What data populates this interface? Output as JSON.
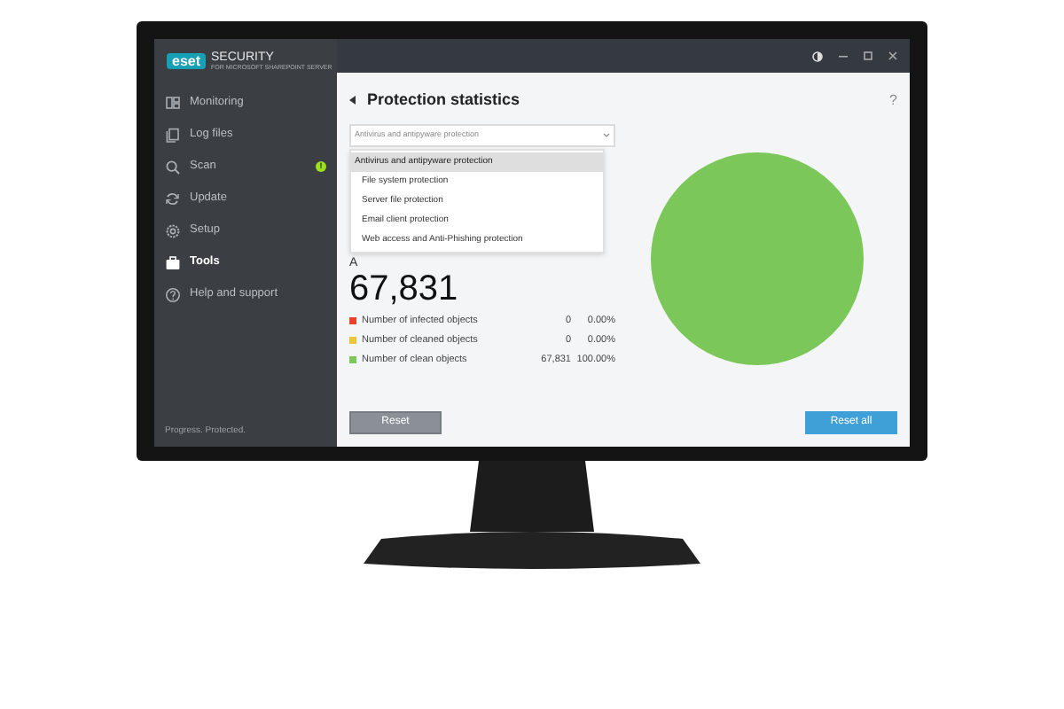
{
  "app": {
    "logo": "eset",
    "product": "SECURITY",
    "subtitle": "FOR MICROSOFT SHAREPOINT SERVER",
    "tagline": "Progress. Protected."
  },
  "sidebar": {
    "items": [
      {
        "label": "Monitoring",
        "selected": false
      },
      {
        "label": "Log files",
        "selected": false
      },
      {
        "label": "Scan",
        "selected": false,
        "badge": "!"
      },
      {
        "label": "Update",
        "selected": false
      },
      {
        "label": "Setup",
        "selected": false
      },
      {
        "label": "Tools",
        "selected": true
      },
      {
        "label": "Help and support",
        "selected": false
      }
    ]
  },
  "page": {
    "title": "Protection statistics",
    "help": "?",
    "dropdown": {
      "value": "Antivirus and antipyware protection",
      "expanded": true,
      "options": [
        {
          "label": "Antivirus and antipyware protection",
          "selected": true
        },
        {
          "label": "File system protection",
          "selected": false
        },
        {
          "label": "Server file protection",
          "selected": false
        },
        {
          "label": "Email client protection",
          "selected": false
        },
        {
          "label": "Web access and Anti-Phishing protection",
          "selected": false
        }
      ]
    },
    "hidden_heading": "A",
    "total": "67,831",
    "legend": [
      {
        "label": "Number of infected objects",
        "count": "0",
        "percent": "0.00%",
        "color": "#e8412c"
      },
      {
        "label": "Number of cleaned objects",
        "count": "0",
        "percent": "0.00%",
        "color": "#f0c43a"
      },
      {
        "label": "Number of clean objects",
        "count": "67,831",
        "percent": "100.00%",
        "color": "#7cc75a"
      }
    ],
    "chart_data": {
      "type": "pie",
      "values": [
        0,
        0,
        100
      ]
    },
    "buttons": [
      {
        "label": "Reset",
        "kind": "secondary"
      },
      {
        "label": "Reset all",
        "kind": "primary"
      }
    ]
  }
}
